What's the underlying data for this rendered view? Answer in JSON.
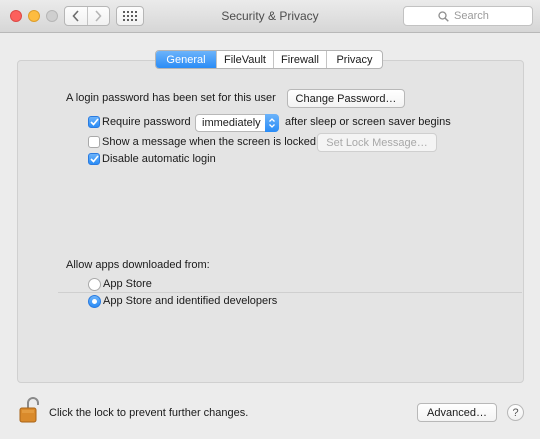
{
  "window": {
    "title": "Security & Privacy",
    "search_placeholder": "Search"
  },
  "tabs": [
    {
      "label": "General",
      "active": true
    },
    {
      "label": "FileVault",
      "active": false
    },
    {
      "label": "Firewall",
      "active": false
    },
    {
      "label": "Privacy",
      "active": false
    }
  ],
  "general": {
    "login_password_text": "A login password has been set for this user",
    "change_password_label": "Change Password…",
    "require_password": {
      "label": "Require password",
      "checked": true,
      "delay_value": "immediately",
      "suffix": "after sleep or screen saver begins"
    },
    "lock_message": {
      "label": "Show a message when the screen is locked",
      "checked": false,
      "button_label": "Set Lock Message…"
    },
    "disable_auto_login": {
      "label": "Disable automatic login",
      "checked": true
    },
    "allow_apps": {
      "heading": "Allow apps downloaded from:",
      "options": [
        {
          "label": "App Store",
          "selected": false
        },
        {
          "label": "App Store and identified developers",
          "selected": true
        }
      ]
    }
  },
  "footer": {
    "lock_text": "Click the lock to prevent further changes.",
    "advanced_label": "Advanced…",
    "help_label": "?"
  },
  "colors": {
    "accent": "#2a8cf6",
    "lock_body": "#d98a2b"
  },
  "icons": {
    "back": "chevron-left-icon",
    "forward": "chevron-right-icon",
    "show_all": "grid-icon",
    "search": "magnifier-icon",
    "lock": "open-padlock-icon"
  }
}
